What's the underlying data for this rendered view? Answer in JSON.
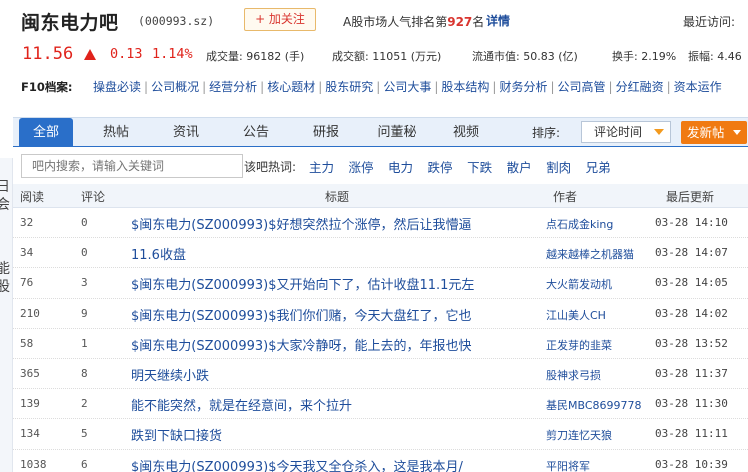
{
  "header": {
    "stock_name": "闽东电力吧",
    "stock_code": "(000993.sz)",
    "follow_label": "+ 加关注",
    "rank_prefix": "A股市场人气排名第",
    "rank_value": "927",
    "rank_suffix": "名",
    "detail_label": "详情",
    "recent_visit": "最近访问:"
  },
  "quote": {
    "price": "11.56",
    "change": "0.13",
    "change_pct": "1.14%",
    "volume": "成交量: 96182 (手)",
    "turnover_amount": "成交额: 11051 (万元)",
    "float_mktcap": "流通市值: 50.83 (亿)",
    "turnover_rate": "换手: 2.19%",
    "amplitude": "振幅: 4.46",
    "color_up": "#e0231b"
  },
  "f10": {
    "label": "F10档案:",
    "links": [
      "操盘必读",
      "公司概况",
      "经营分析",
      "核心题材",
      "股东研究",
      "公司大事",
      "股本结构",
      "财务分析",
      "公司高管",
      "分红融资",
      "资本运作"
    ]
  },
  "tabs": [
    {
      "label": "全部",
      "active": true
    },
    {
      "label": "热帖"
    },
    {
      "label": "资讯"
    },
    {
      "label": "公告"
    },
    {
      "label": "研报"
    },
    {
      "label": "问董秘"
    },
    {
      "label": "视频"
    }
  ],
  "sort": {
    "label": "排序:",
    "selected": "评论时间"
  },
  "post_button": "发新帖",
  "side_strip": [
    "日",
    "会",
    "能",
    "股"
  ],
  "search": {
    "placeholder": "吧内搜索，请输入关键词",
    "hot_label": "该吧热词:",
    "hot_words": [
      "主力",
      "涨停",
      "电力",
      "跌停",
      "下跌",
      "散户",
      "割肉",
      "兄弟"
    ]
  },
  "table": {
    "headers": {
      "read": "阅读",
      "comments": "评论",
      "title": "标题",
      "author": "作者",
      "updated": "最后更新"
    },
    "rows": [
      {
        "read": "32",
        "comments": "0",
        "title": "$闽东电力(SZ000993)$好想突然拉个涨停，然后让我懵逼",
        "author": "点石成金king",
        "updated": "03-28 14:10"
      },
      {
        "read": "34",
        "comments": "0",
        "title": "11.6收盘",
        "author": "越来越棒之机器猫",
        "updated": "03-28 14:07"
      },
      {
        "read": "76",
        "comments": "3",
        "title": "$闽东电力(SZ000993)$又开始向下了，估计收盘11.1元左",
        "author": "大火箭发动机",
        "updated": "03-28 14:05"
      },
      {
        "read": "210",
        "comments": "9",
        "title": "$闽东电力(SZ000993)$我们你们赌，今天大盘红了，它也",
        "author": "江山美人CH",
        "updated": "03-28 14:02"
      },
      {
        "read": "58",
        "comments": "1",
        "title": "$闽东电力(SZ000993)$大家冷静呀，能上去的，年报也快",
        "author": "正发芽的韭菜",
        "updated": "03-28 13:52"
      },
      {
        "read": "365",
        "comments": "8",
        "title": "明天继续小跌",
        "author": "股神求弓损",
        "updated": "03-28 11:37"
      },
      {
        "read": "139",
        "comments": "2",
        "title": "能不能突然，就是在经意间，来个拉升",
        "author": "基民MBC8699778",
        "updated": "03-28 11:30"
      },
      {
        "read": "134",
        "comments": "5",
        "title": "跌到下缺口接货",
        "author": "剪刀连忆天狼",
        "updated": "03-28 11:11"
      },
      {
        "read": "1038",
        "comments": "6",
        "title": "$闽东电力(SZ000993)$今天我又全仓杀入，这是我本月/",
        "author": "平阳将军",
        "updated": "03-28 10:39"
      }
    ]
  }
}
